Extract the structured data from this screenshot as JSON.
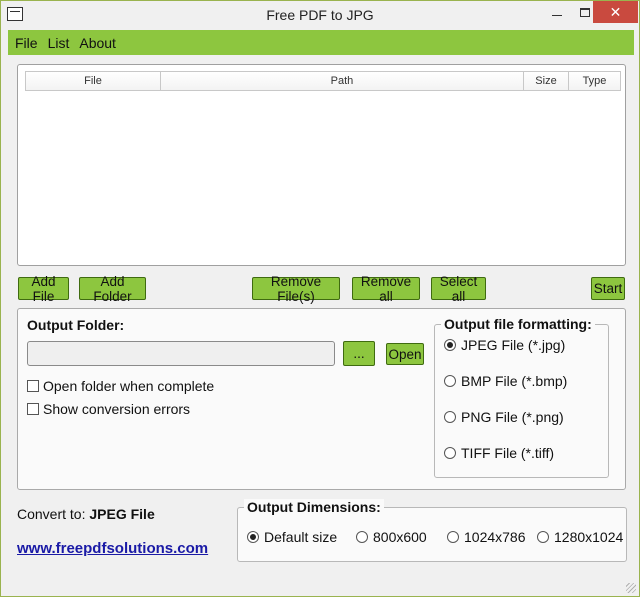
{
  "window": {
    "title": "Free PDF to JPG",
    "controls": {
      "minimize": "minimize-icon",
      "maximize": "maximize-icon",
      "close": "✕"
    }
  },
  "menu": {
    "items": [
      {
        "label": "File"
      },
      {
        "label": "List"
      },
      {
        "label": "About"
      }
    ]
  },
  "file_list": {
    "columns": [
      "File",
      "Path",
      "Size",
      "Type"
    ],
    "rows": []
  },
  "actions": {
    "add_file": "Add File",
    "add_folder": "Add Folder",
    "remove_files": "Remove File(s)",
    "remove_all": "Remove all",
    "select_all": "Select all",
    "start": "Start"
  },
  "output_folder": {
    "label": "Output Folder:",
    "value": "",
    "browse": "...",
    "open": "Open",
    "open_when_complete": {
      "label": "Open folder when complete",
      "checked": false
    },
    "show_errors": {
      "label": "Show conversion errors",
      "checked": false
    }
  },
  "formatting": {
    "title": "Output file formatting:",
    "options": [
      {
        "label": "JPEG File (*.jpg)",
        "checked": true
      },
      {
        "label": "BMP File (*.bmp)",
        "checked": false
      },
      {
        "label": "PNG File (*.png)",
        "checked": false
      },
      {
        "label": "TIFF File (*.tiff)",
        "checked": false
      }
    ]
  },
  "convert": {
    "label": "Convert to:",
    "value": "JPEG File"
  },
  "website": "www.freepdfsolutions.com",
  "dimensions": {
    "title": "Output Dimensions:",
    "options": [
      {
        "label": "Default size",
        "checked": true
      },
      {
        "label": "800x600",
        "checked": false
      },
      {
        "label": "1024x786",
        "checked": false
      },
      {
        "label": "1280x1024",
        "checked": false
      }
    ]
  },
  "colors": {
    "accent_green": "#8dc63f",
    "link_blue": "#1a1aa6",
    "close_red": "#c94a3f"
  }
}
